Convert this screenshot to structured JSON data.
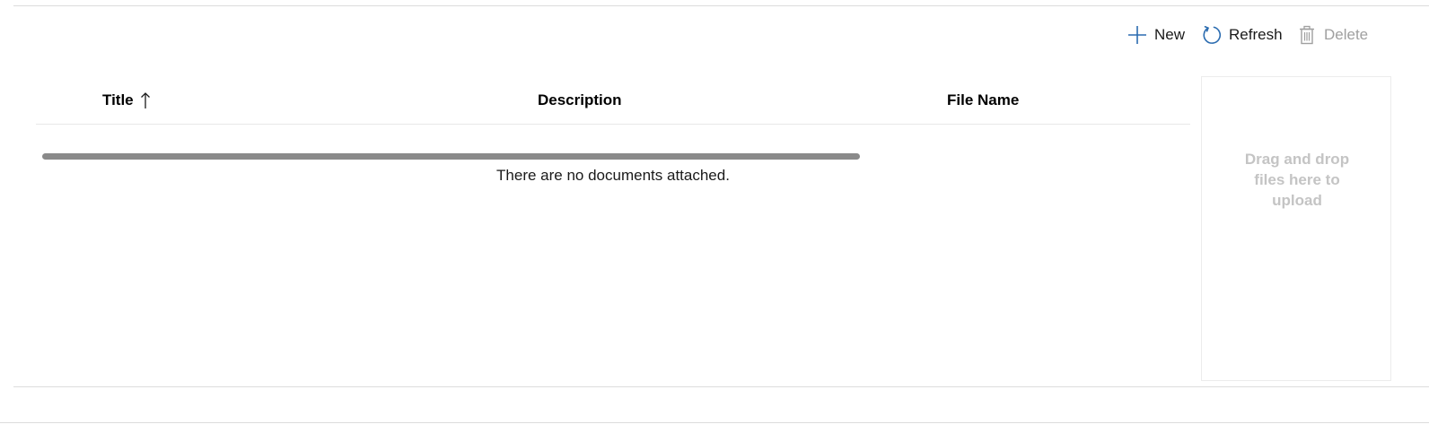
{
  "toolbar": {
    "new_label": "New",
    "refresh_label": "Refresh",
    "delete_label": "Delete"
  },
  "grid": {
    "columns": [
      {
        "label": "Title",
        "sort": "ascending"
      },
      {
        "label": "Description"
      },
      {
        "label": "File Name"
      }
    ],
    "empty_message": "There are no documents attached."
  },
  "drop_zone": {
    "text": "Drag and drop files here to upload"
  },
  "colors": {
    "accent": "#2b6cb0",
    "disabled": "#a0a0a0",
    "drop_text": "#c4c4c4"
  },
  "icons": {
    "new": "plus-icon",
    "refresh": "refresh-icon",
    "delete": "trash-icon",
    "sort": "sort-ascending-icon"
  }
}
